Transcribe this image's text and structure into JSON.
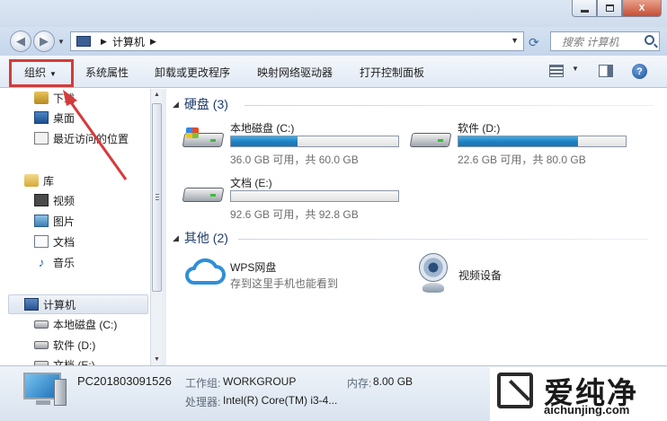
{
  "window": {
    "minimize_icon": "minimize-icon",
    "maximize_icon": "maximize-icon",
    "close_label": "X"
  },
  "address": {
    "location": "计算机",
    "search_placeholder": "搜索 计算机"
  },
  "toolbar": {
    "organize": "组织",
    "system_properties": "系统属性",
    "uninstall": "卸载或更改程序",
    "map_drive": "映射网络驱动器",
    "control_panel": "打开控制面板",
    "help": "?"
  },
  "sidebar": {
    "items": [
      {
        "label": "下载",
        "icon": "download-folder-icon"
      },
      {
        "label": "桌面",
        "icon": "desktop-icon"
      },
      {
        "label": "最近访问的位置",
        "icon": "recent-places-icon"
      },
      {
        "label": "库",
        "icon": "library-icon"
      },
      {
        "label": "视频",
        "icon": "video-icon"
      },
      {
        "label": "图片",
        "icon": "pictures-icon"
      },
      {
        "label": "文档",
        "icon": "documents-icon"
      },
      {
        "label": "音乐",
        "icon": "music-icon"
      },
      {
        "label": "计算机",
        "icon": "computer-icon"
      },
      {
        "label": "本地磁盘 (C:)",
        "icon": "drive-icon"
      },
      {
        "label": "软件 (D:)",
        "icon": "drive-icon"
      },
      {
        "label": "文档 (E:)",
        "icon": "drive-icon"
      }
    ]
  },
  "main": {
    "hard_disks_header": "硬盘 (3)",
    "drives": [
      {
        "name": "本地磁盘 (C:)",
        "info": "36.0 GB 可用，共 60.0 GB",
        "used_fraction": 0.4
      },
      {
        "name": "软件 (D:)",
        "info": "22.6 GB 可用，共 80.0 GB",
        "used_fraction": 0.7175
      },
      {
        "name": "文档 (E:)",
        "info": "92.6 GB 可用，共 92.8 GB",
        "used_fraction": 0.002
      }
    ],
    "other_header": "其他 (2)",
    "other_items": [
      {
        "name": "WPS网盘",
        "desc": "存到这里手机也能看到"
      },
      {
        "name": "视频设备",
        "desc": ""
      }
    ]
  },
  "details": {
    "pc_name": "PC201803091526",
    "workgroup_label": "工作组:",
    "workgroup_value": "WORKGROUP",
    "memory_label": "内存:",
    "memory_value": "8.00 GB",
    "processor_label": "处理器:",
    "processor_value": "Intel(R) Core(TM) i3-4..."
  },
  "watermark": {
    "brand": "爱纯净",
    "url": "aichunjing.com"
  },
  "colors": {
    "accent": "#1f7fbf",
    "annotation": "#d63a3a",
    "header_text": "#1e3c6c"
  }
}
